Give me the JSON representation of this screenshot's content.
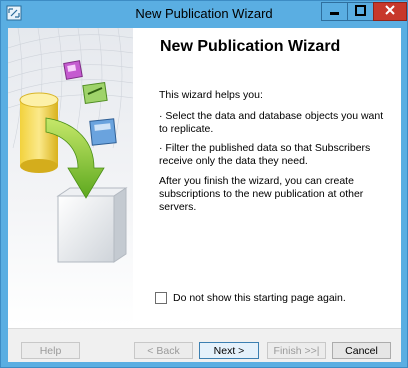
{
  "window": {
    "title": "New Publication Wizard"
  },
  "page": {
    "heading": "New Publication Wizard",
    "intro": "This wizard helps you:",
    "bullet1": "· Select the data and database objects you want to replicate.",
    "bullet2": "· Filter the published data so that Subscribers receive only the data they need.",
    "closing": "After you finish the wizard, you can create subscriptions to the new publication at other servers."
  },
  "checkbox": {
    "label": "Do not show this starting page again.",
    "checked": false
  },
  "buttons": {
    "help": "Help",
    "back": "< Back",
    "next": "Next >",
    "finish": "Finish >>|",
    "cancel": "Cancel"
  },
  "icons": {
    "app": "sql-server-app-icon",
    "minimize": "minimize-icon",
    "maximize": "maximize-icon",
    "close": "close-icon",
    "art": "wizard-database-illustration"
  }
}
